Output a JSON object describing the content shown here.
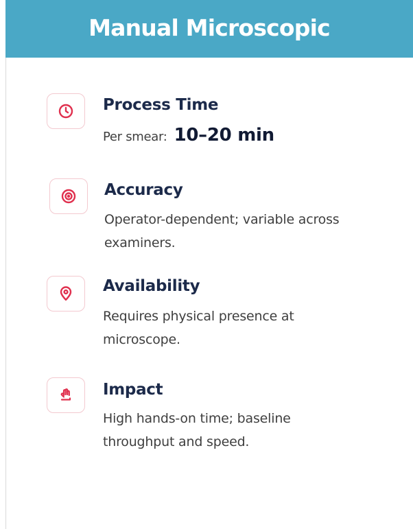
{
  "header": {
    "title": "Manual Microscopic"
  },
  "items": [
    {
      "icon": "clock-icon",
      "title": "Process Time",
      "label": "Per smear:",
      "value": "10–20 min"
    },
    {
      "icon": "target-icon",
      "title": "Accuracy",
      "description": "Operator-dependent; variable across examiners."
    },
    {
      "icon": "location-pin-icon",
      "title": "Availability",
      "description": "Requires physical presence at microscope."
    },
    {
      "icon": "hand-icon",
      "title": "Impact",
      "description": "High hands-on time; baseline throughput and speed."
    }
  ],
  "colors": {
    "header_bg": "#4aa8c6",
    "header_text": "#ffffff",
    "icon_accent": "#e0304e",
    "icon_border": "#f3c9cf",
    "title_text": "#1c2a4a",
    "body_text": "#3f3f3f"
  }
}
